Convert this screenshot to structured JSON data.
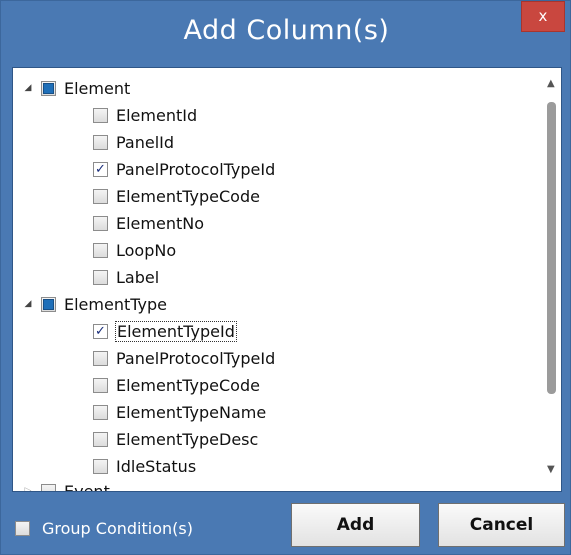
{
  "window": {
    "title": "Add Column(s)",
    "close_label": "x"
  },
  "tree": {
    "groups": [
      {
        "label": "Element",
        "expanded": true,
        "state": "partial",
        "items": [
          {
            "label": "ElementId",
            "checked": false
          },
          {
            "label": "PanelId",
            "checked": false
          },
          {
            "label": "PanelProtocolTypeId",
            "checked": true
          },
          {
            "label": "ElementTypeCode",
            "checked": false
          },
          {
            "label": "ElementNo",
            "checked": false
          },
          {
            "label": "LoopNo",
            "checked": false
          },
          {
            "label": "Label",
            "checked": false
          }
        ]
      },
      {
        "label": "ElementType",
        "expanded": true,
        "state": "partial",
        "items": [
          {
            "label": "ElementTypeId",
            "checked": true,
            "focused": true
          },
          {
            "label": "PanelProtocolTypeId",
            "checked": false
          },
          {
            "label": "ElementTypeCode",
            "checked": false
          },
          {
            "label": "ElementTypeName",
            "checked": false
          },
          {
            "label": "ElementTypeDesc",
            "checked": false
          },
          {
            "label": "IdleStatus",
            "checked": false
          }
        ]
      },
      {
        "label": "Event",
        "expanded": false,
        "state": "unchecked",
        "items": []
      }
    ]
  },
  "footer": {
    "group_condition_label": "Group Condition(s)",
    "group_condition_checked": false,
    "add_label": "Add",
    "cancel_label": "Cancel"
  }
}
